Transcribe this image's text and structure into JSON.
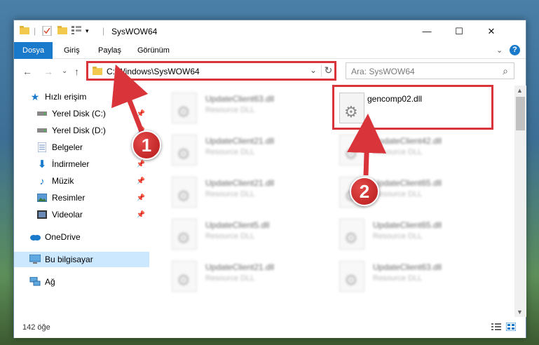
{
  "window": {
    "title": "SysWOW64",
    "minimize": "—",
    "maximize": "☐",
    "close": "✕"
  },
  "ribbon": {
    "tabs": [
      "Dosya",
      "Giriş",
      "Paylaş",
      "Görünüm"
    ],
    "expand": "⌄",
    "help": "?"
  },
  "address": {
    "path": "C:\\Windows\\SysWOW64",
    "search_placeholder": "Ara: SysWOW64",
    "back": "←",
    "forward": "→",
    "recent": "⌄",
    "up": "↑",
    "dropdown": "⌄",
    "refresh": "↻",
    "search_icon": "⌕"
  },
  "nav": {
    "items": [
      {
        "label": "Hızlı erişim",
        "icon": "star-icon",
        "pinned": false
      },
      {
        "label": "Yerel Disk (C:)",
        "icon": "drive-icon",
        "pinned": true
      },
      {
        "label": "Yerel Disk (D:)",
        "icon": "drive-icon",
        "pinned": true
      },
      {
        "label": "Belgeler",
        "icon": "document-icon",
        "pinned": true
      },
      {
        "label": "İndirmeler",
        "icon": "download-icon",
        "pinned": true
      },
      {
        "label": "Müzik",
        "icon": "music-icon",
        "pinned": true
      },
      {
        "label": "Resimler",
        "icon": "pictures-icon",
        "pinned": true
      },
      {
        "label": "Videolar",
        "icon": "video-icon",
        "pinned": true
      },
      {
        "label": "OneDrive",
        "icon": "cloud-icon",
        "pinned": false
      },
      {
        "label": "Bu bilgisayar",
        "icon": "computer-icon",
        "pinned": false
      },
      {
        "label": "Ağ",
        "icon": "network-icon",
        "pinned": false
      }
    ]
  },
  "files": {
    "left": [
      {
        "name": "UpdateClient63.dll",
        "type": "Resource DLL"
      },
      {
        "name": "UpdateClient21.dll",
        "type": "Resource DLL"
      },
      {
        "name": "UpdateClient21.dll",
        "type": "Resource DLL"
      },
      {
        "name": "UpdateClient5.dll",
        "type": "Resource DLL"
      },
      {
        "name": "UpdateClient21.dll",
        "type": "Resource DLL"
      }
    ],
    "right": [
      {
        "name": "gencomp02.dll",
        "type": ""
      },
      {
        "name": "UpdateClient42.dll",
        "type": "Resource DLL"
      },
      {
        "name": "UpdateClient65.dll",
        "type": "Resource DLL"
      },
      {
        "name": "UpdateClient65.dll",
        "type": "Resource DLL"
      },
      {
        "name": "UpdateClient63.dll",
        "type": "Resource DLL"
      }
    ]
  },
  "status": {
    "count": "142 öğe"
  },
  "annotations": {
    "step1": "1",
    "step2": "2",
    "color": "#d9343a"
  }
}
